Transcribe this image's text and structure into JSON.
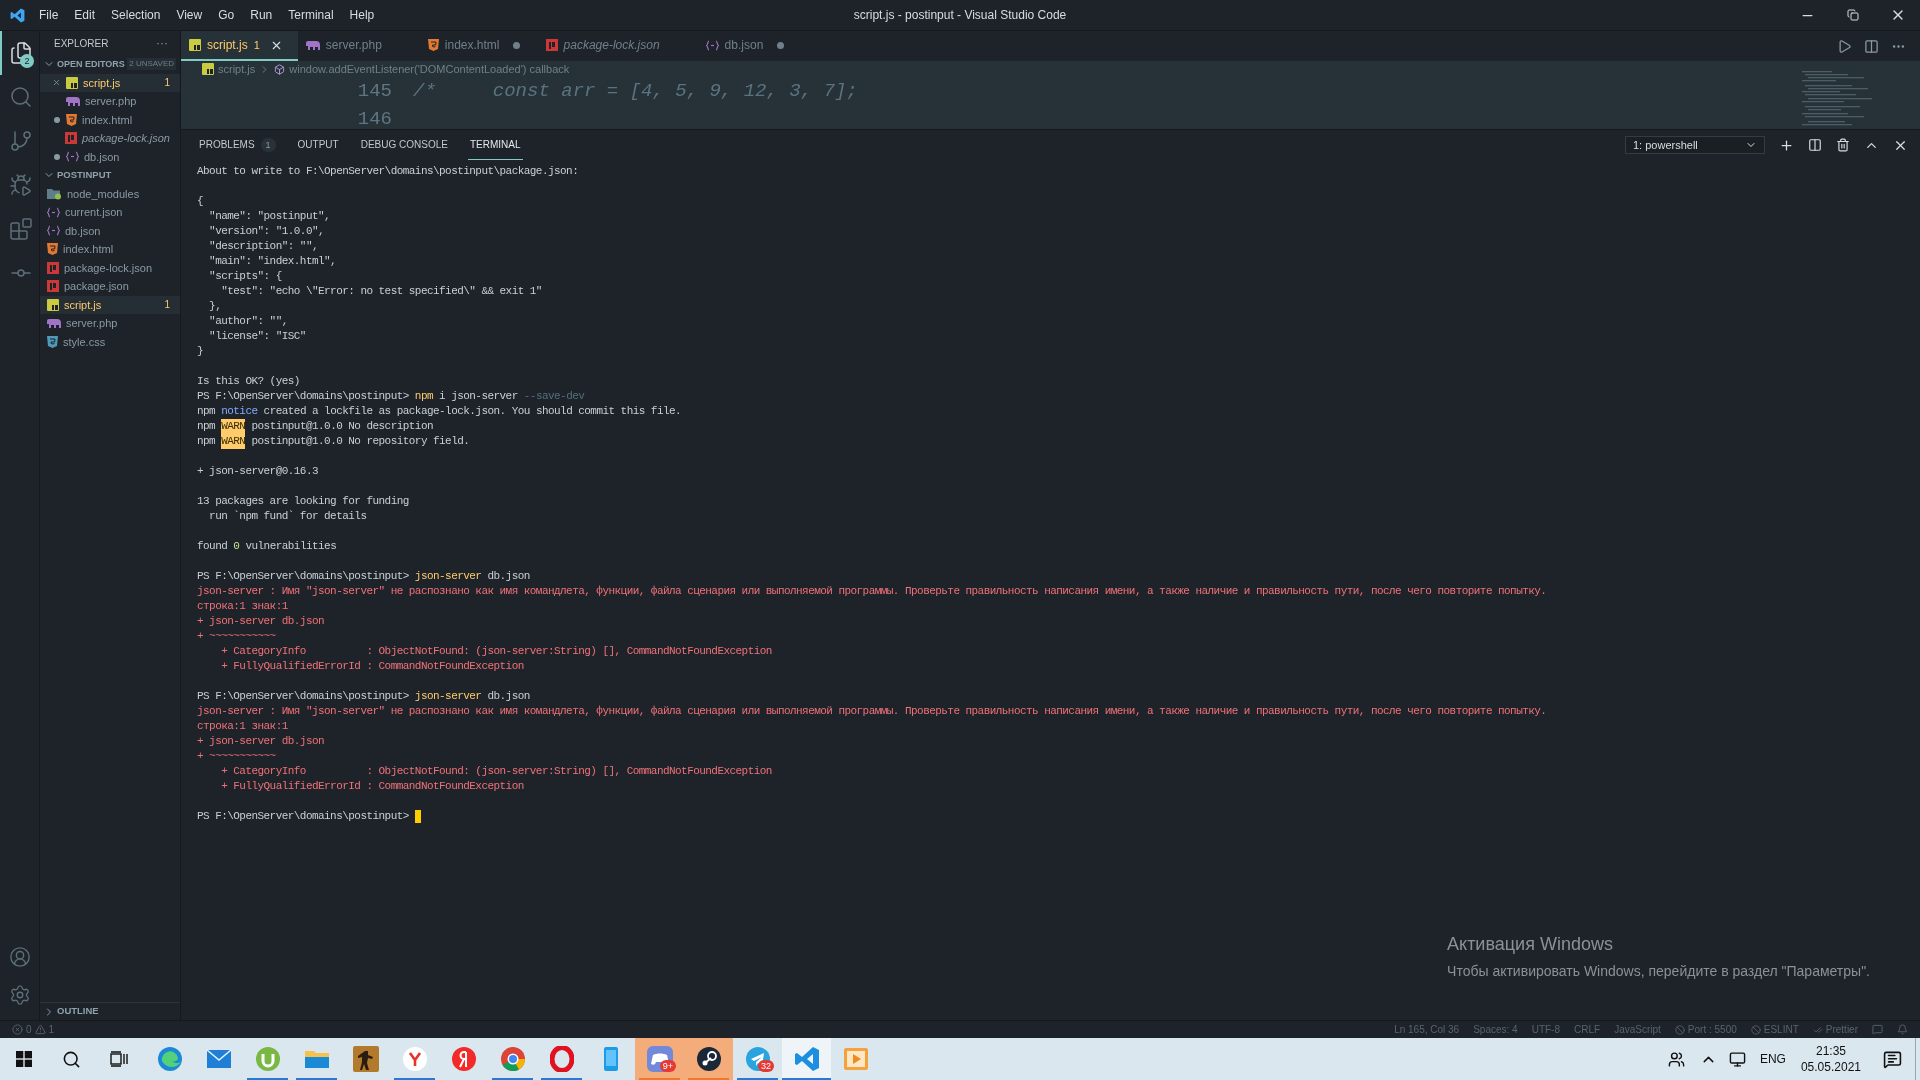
{
  "window": {
    "title": "script.js - postinput - Visual Studio Code"
  },
  "menu": [
    "File",
    "Edit",
    "Selection",
    "View",
    "Go",
    "Run",
    "Terminal",
    "Help"
  ],
  "activity_bar": {
    "items": [
      {
        "selected": true,
        "badge": "2"
      },
      {
        "selected": false
      },
      {
        "selected": false
      },
      {
        "selected": false
      },
      {
        "selected": false
      },
      {
        "selected": false
      }
    ]
  },
  "sidebar": {
    "title": "EXPLORER",
    "more": "···",
    "open_editors": {
      "title": "OPEN EDITORS",
      "expanded": true,
      "badge": "2 UNSAVED",
      "items": [
        {
          "name": "script.js",
          "kind": "js",
          "selected": true,
          "modified": false,
          "italic": false,
          "problems": "1"
        },
        {
          "name": "server.php",
          "kind": "php",
          "selected": false,
          "modified": false,
          "italic": false
        },
        {
          "name": "index.html",
          "kind": "html",
          "selected": false,
          "modified": true,
          "italic": false
        },
        {
          "name": "package-lock.json",
          "kind": "package",
          "selected": false,
          "modified": false,
          "italic": true
        },
        {
          "name": "db.json",
          "kind": "json",
          "selected": false,
          "modified": true,
          "italic": false
        }
      ]
    },
    "folder": {
      "title": "POSTINPUT",
      "expanded": true,
      "items": [
        {
          "name": "node_modules",
          "kind": "folder",
          "selected": false
        },
        {
          "name": "current.json",
          "kind": "json",
          "selected": false
        },
        {
          "name": "db.json",
          "kind": "json",
          "selected": false
        },
        {
          "name": "index.html",
          "kind": "html",
          "selected": false
        },
        {
          "name": "package-lock.json",
          "kind": "package",
          "selected": false
        },
        {
          "name": "package.json",
          "kind": "package",
          "selected": false
        },
        {
          "name": "script.js",
          "kind": "js",
          "selected": true,
          "problems": "1"
        },
        {
          "name": "server.php",
          "kind": "php",
          "selected": false
        },
        {
          "name": "style.css",
          "kind": "css",
          "selected": false
        }
      ]
    },
    "outline": {
      "title": "OUTLINE",
      "expanded": false
    }
  },
  "tabs": [
    {
      "label": "script.js",
      "kind": "js",
      "selected": true,
      "modified": false,
      "italic": false,
      "problems": "1"
    },
    {
      "label": "server.php",
      "kind": "php",
      "selected": false,
      "modified": false,
      "italic": false
    },
    {
      "label": "index.html",
      "kind": "html",
      "selected": false,
      "modified": true,
      "italic": false
    },
    {
      "label": "package-lock.json",
      "kind": "package",
      "selected": false,
      "modified": false,
      "italic": true
    },
    {
      "label": "db.json",
      "kind": "json",
      "selected": false,
      "modified": true,
      "italic": false
    }
  ],
  "breadcrumb": [
    "script.js",
    "window.addEventListener('DOMContentLoaded') callback"
  ],
  "editor": {
    "lines": [
      {
        "number": "145",
        "code": "/*     const arr = [4, 5, 9, 12, 3, 7];"
      },
      {
        "number": "146"
      }
    ]
  },
  "panel": {
    "tabs": [
      {
        "label": "PROBLEMS",
        "badge": "1",
        "selected": false
      },
      {
        "label": "OUTPUT",
        "selected": false
      },
      {
        "label": "DEBUG CONSOLE",
        "selected": false
      },
      {
        "label": "TERMINAL",
        "selected": true
      }
    ],
    "terminal_select": "1: powershell"
  },
  "terminal": {
    "cursor": true,
    "blocks": [
      [
        [
          {
            "text": "About to write to F:\\OpenServer\\domains\\postinput\\package.json:",
            "kind": "plain"
          }
        ]
      ],
      [
        [
          {
            "text": "{",
            "kind": "plain"
          }
        ],
        [
          {
            "text": "  \"name\": \"postinput\",",
            "kind": "plain"
          }
        ],
        [
          {
            "text": "  \"version\": \"1.0.0\",",
            "kind": "plain"
          }
        ],
        [
          {
            "text": "  \"description\": \"\",",
            "kind": "plain"
          }
        ],
        [
          {
            "text": "  \"main\": \"index.html\",",
            "kind": "plain"
          }
        ],
        [
          {
            "text": "  \"scripts\": {",
            "kind": "plain"
          }
        ],
        [
          {
            "text": "    \"test\": \"echo \\\"Error: no test specified\\\" && exit 1\"",
            "kind": "plain"
          }
        ],
        [
          {
            "text": "  },",
            "kind": "plain"
          }
        ],
        [
          {
            "text": "  \"author\": \"\",",
            "kind": "plain"
          }
        ],
        [
          {
            "text": "  \"license\": \"ISC\"",
            "kind": "plain"
          }
        ],
        [
          {
            "text": "}",
            "kind": "plain"
          }
        ]
      ],
      [
        [
          {
            "text": "Is this OK? (yes)",
            "kind": "plain"
          }
        ],
        [
          {
            "text": "PS F:\\OpenServer\\domains\\postinput> ",
            "kind": "plain"
          },
          {
            "text": "npm",
            "kind": "command"
          },
          {
            "text": " i json-server ",
            "kind": "plain"
          },
          {
            "text": "--save-dev",
            "kind": "flag"
          }
        ],
        [
          {
            "text": "npm ",
            "kind": "plain"
          },
          {
            "text": "notice",
            "kind": "notice"
          },
          {
            "text": " created a lockfile as package-lock.json. You should commit this file.",
            "kind": "plain"
          }
        ],
        [
          {
            "text": "npm ",
            "kind": "plain"
          },
          {
            "text": "WARN",
            "kind": "warn"
          },
          {
            "text": " postinput@1.0.0 No description",
            "kind": "plain"
          }
        ],
        [
          {
            "text": "npm ",
            "kind": "plain"
          },
          {
            "text": "WARN",
            "kind": "warn"
          },
          {
            "text": " postinput@1.0.0 No repository field.",
            "kind": "plain"
          }
        ]
      ],
      [
        [
          {
            "text": "+ json-server@0.16.3",
            "kind": "plain"
          }
        ]
      ],
      [
        [
          {
            "text": "13 packages are looking for funding",
            "kind": "plain"
          }
        ],
        [
          {
            "text": "  run `npm fund` for details",
            "kind": "plain"
          }
        ]
      ],
      [
        [
          {
            "text": "found ",
            "kind": "plain"
          },
          {
            "text": "0",
            "kind": "success"
          },
          {
            "text": " vulnerabilities",
            "kind": "plain"
          }
        ]
      ],
      [
        [
          {
            "text": "PS F:\\OpenServer\\domains\\postinput> ",
            "kind": "plain"
          },
          {
            "text": "json-server",
            "kind": "command"
          },
          {
            "text": " db.json",
            "kind": "plain"
          }
        ],
        [
          {
            "text": "json-server : Имя \"json-server\" не распознано как имя командлета, функции, файла сценария или выполняемой программы. Проверьте правильность написания имени, а также наличие и правильность пути, после чего повторите попытку.",
            "kind": "error"
          }
        ],
        [
          {
            "text": "строка:1 знак:1",
            "kind": "error"
          }
        ],
        [
          {
            "text": "+ json-server db.json",
            "kind": "error"
          }
        ],
        [
          {
            "text": "+ ~~~~~~~~~~~",
            "kind": "error"
          }
        ],
        [
          {
            "text": "    + CategoryInfo          : ObjectNotFound: (json-server:String) [], CommandNotFoundException",
            "kind": "error"
          }
        ],
        [
          {
            "text": "    + FullyQualifiedErrorId : CommandNotFoundException",
            "kind": "error"
          }
        ]
      ],
      [
        [
          {
            "text": "PS F:\\OpenServer\\domains\\postinput> ",
            "kind": "plain"
          },
          {
            "text": "json-server",
            "kind": "command"
          },
          {
            "text": " db.json",
            "kind": "plain"
          }
        ],
        [
          {
            "text": "json-server : Имя \"json-server\" не распознано как имя командлета, функции, файла сценария или выполняемой программы. Проверьте правильность написания имени, а также наличие и правильность пути, после чего повторите попытку.",
            "kind": "error"
          }
        ],
        [
          {
            "text": "строка:1 знак:1",
            "kind": "error"
          }
        ],
        [
          {
            "text": "+ json-server db.json",
            "kind": "error"
          }
        ],
        [
          {
            "text": "+ ~~~~~~~~~~~",
            "kind": "error"
          }
        ],
        [
          {
            "text": "    + CategoryInfo          : ObjectNotFound: (json-server:String) [], CommandNotFoundException",
            "kind": "error"
          }
        ],
        [
          {
            "text": "    + FullyQualifiedErrorId : CommandNotFoundException",
            "kind": "error"
          }
        ]
      ],
      [
        [
          {
            "text": "PS F:\\OpenServer\\domains\\postinput> ",
            "kind": "plain"
          }
        ]
      ]
    ]
  },
  "activation": {
    "title": "Активация Windows",
    "text": "Чтобы активировать Windows, перейдите в раздел \"Параметры\"."
  },
  "status_bar": {
    "errors": "0",
    "warnings": "1",
    "items": [
      {
        "text": "Ln 165, Col 36",
        "kind": "text"
      },
      {
        "text": "Spaces: 4",
        "kind": "text"
      },
      {
        "text": "UTF-8",
        "kind": "text"
      },
      {
        "text": "CRLF",
        "kind": "text"
      },
      {
        "text": "JavaScript",
        "kind": "text"
      },
      {
        "text": "Port : 5500",
        "kind": "blocked"
      },
      {
        "text": "ESLINT",
        "kind": "blocked"
      },
      {
        "text": "Prettier",
        "kind": "checks"
      }
    ]
  },
  "taskbar": {
    "apps": [
      {
        "running": false,
        "flashing": false,
        "active": false
      },
      {
        "running": false,
        "flashing": false,
        "active": false
      },
      {
        "running": true,
        "flashing": false,
        "active": false
      },
      {
        "running": true,
        "flashing": false,
        "active": false
      },
      {
        "running": false,
        "flashing": false,
        "active": false
      },
      {
        "running": true,
        "flashing": false,
        "active": false
      },
      {
        "running": false,
        "flashing": false,
        "active": false
      },
      {
        "running": true,
        "flashing": false,
        "active": false
      },
      {
        "running": true,
        "flashing": false,
        "active": false
      },
      {
        "running": false,
        "flashing": false,
        "active": false
      },
      {
        "running": true,
        "flashing": true,
        "active": false,
        "badge": "9+"
      },
      {
        "running": true,
        "flashing": true,
        "active": false
      },
      {
        "running": true,
        "flashing": false,
        "active": false,
        "badge": "32"
      },
      {
        "running": true,
        "flashing": false,
        "active": true
      },
      {
        "running": false,
        "flashing": false,
        "active": false
      }
    ],
    "language": "ENG",
    "time": "21:35",
    "date": "05.05.2021"
  }
}
